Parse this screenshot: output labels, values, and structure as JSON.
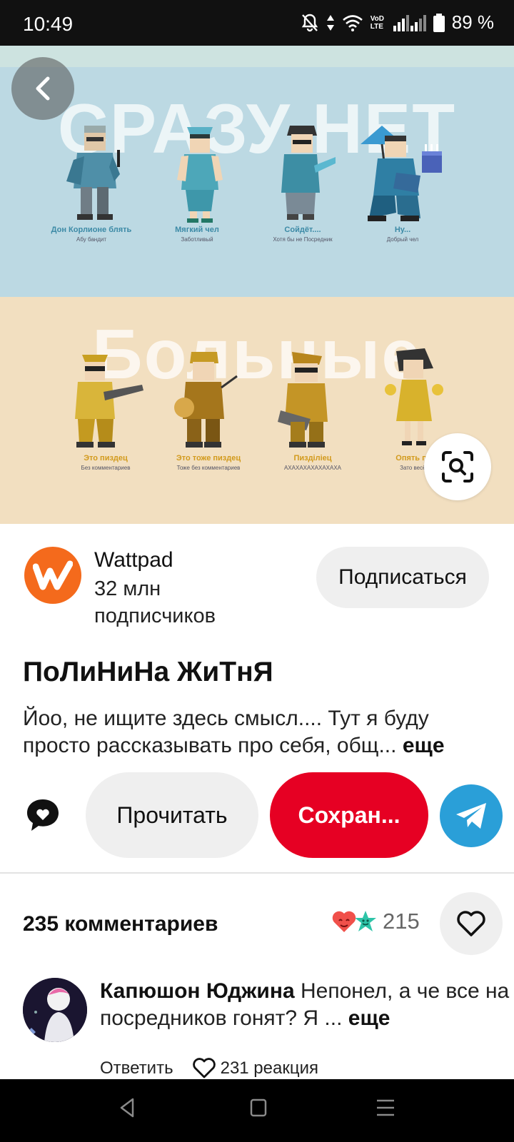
{
  "status_bar": {
    "time": "10:49",
    "network": "VoD LTE",
    "battery": "89 %"
  },
  "hero": {
    "top_word": "СРАЗУ НЕТ",
    "top_characters": [
      {
        "title": "Дон Корлионе блять",
        "subtitle": "Абу бандит"
      },
      {
        "title": "Мягкий чел",
        "subtitle": "Заботливый"
      },
      {
        "title": "Сойдёт....",
        "subtitle": "Хотя бы не Посредник"
      },
      {
        "title": "Ну...",
        "subtitle": "Добрый чел"
      }
    ],
    "bottom_word": "Больные",
    "bottom_characters": [
      {
        "title": "Это пиздец",
        "subtitle": "Без комментариев"
      },
      {
        "title": "Это тоже пиздец",
        "subtitle": "Тоже без комментариев"
      },
      {
        "title": "Пиздiлiец",
        "subtitle": "АХАХАХАХАХАХАХА"
      },
      {
        "title": "Опять пи...",
        "subtitle": "Зато весёл..."
      }
    ]
  },
  "author": {
    "name": "Wattpad",
    "subscribers": "32 млн подписчиков",
    "subscribe_label": "Подписаться"
  },
  "pin": {
    "title": "ПоЛиНиНа ЖиТнЯ",
    "description": "Йоо, не ищите здесь смысл.... Тут я буду просто рассказывать про себя, общ...",
    "more": "еще"
  },
  "actions": {
    "read_label": "Прочитать",
    "save_label": "Сохран..."
  },
  "comments": {
    "heading": "235 комментариев",
    "reaction_count": "215",
    "items": [
      {
        "author": "Капюшон Юджина",
        "text": "Непонел, а че все на посредников гонят? Я ...",
        "more": "еще",
        "reply_label": "Ответить",
        "reactions_label": "231 реакция"
      }
    ]
  },
  "colors": {
    "save_red": "#e60023",
    "wattpad_orange": "#f46a1c",
    "telegram_blue": "#2a9fd8"
  }
}
